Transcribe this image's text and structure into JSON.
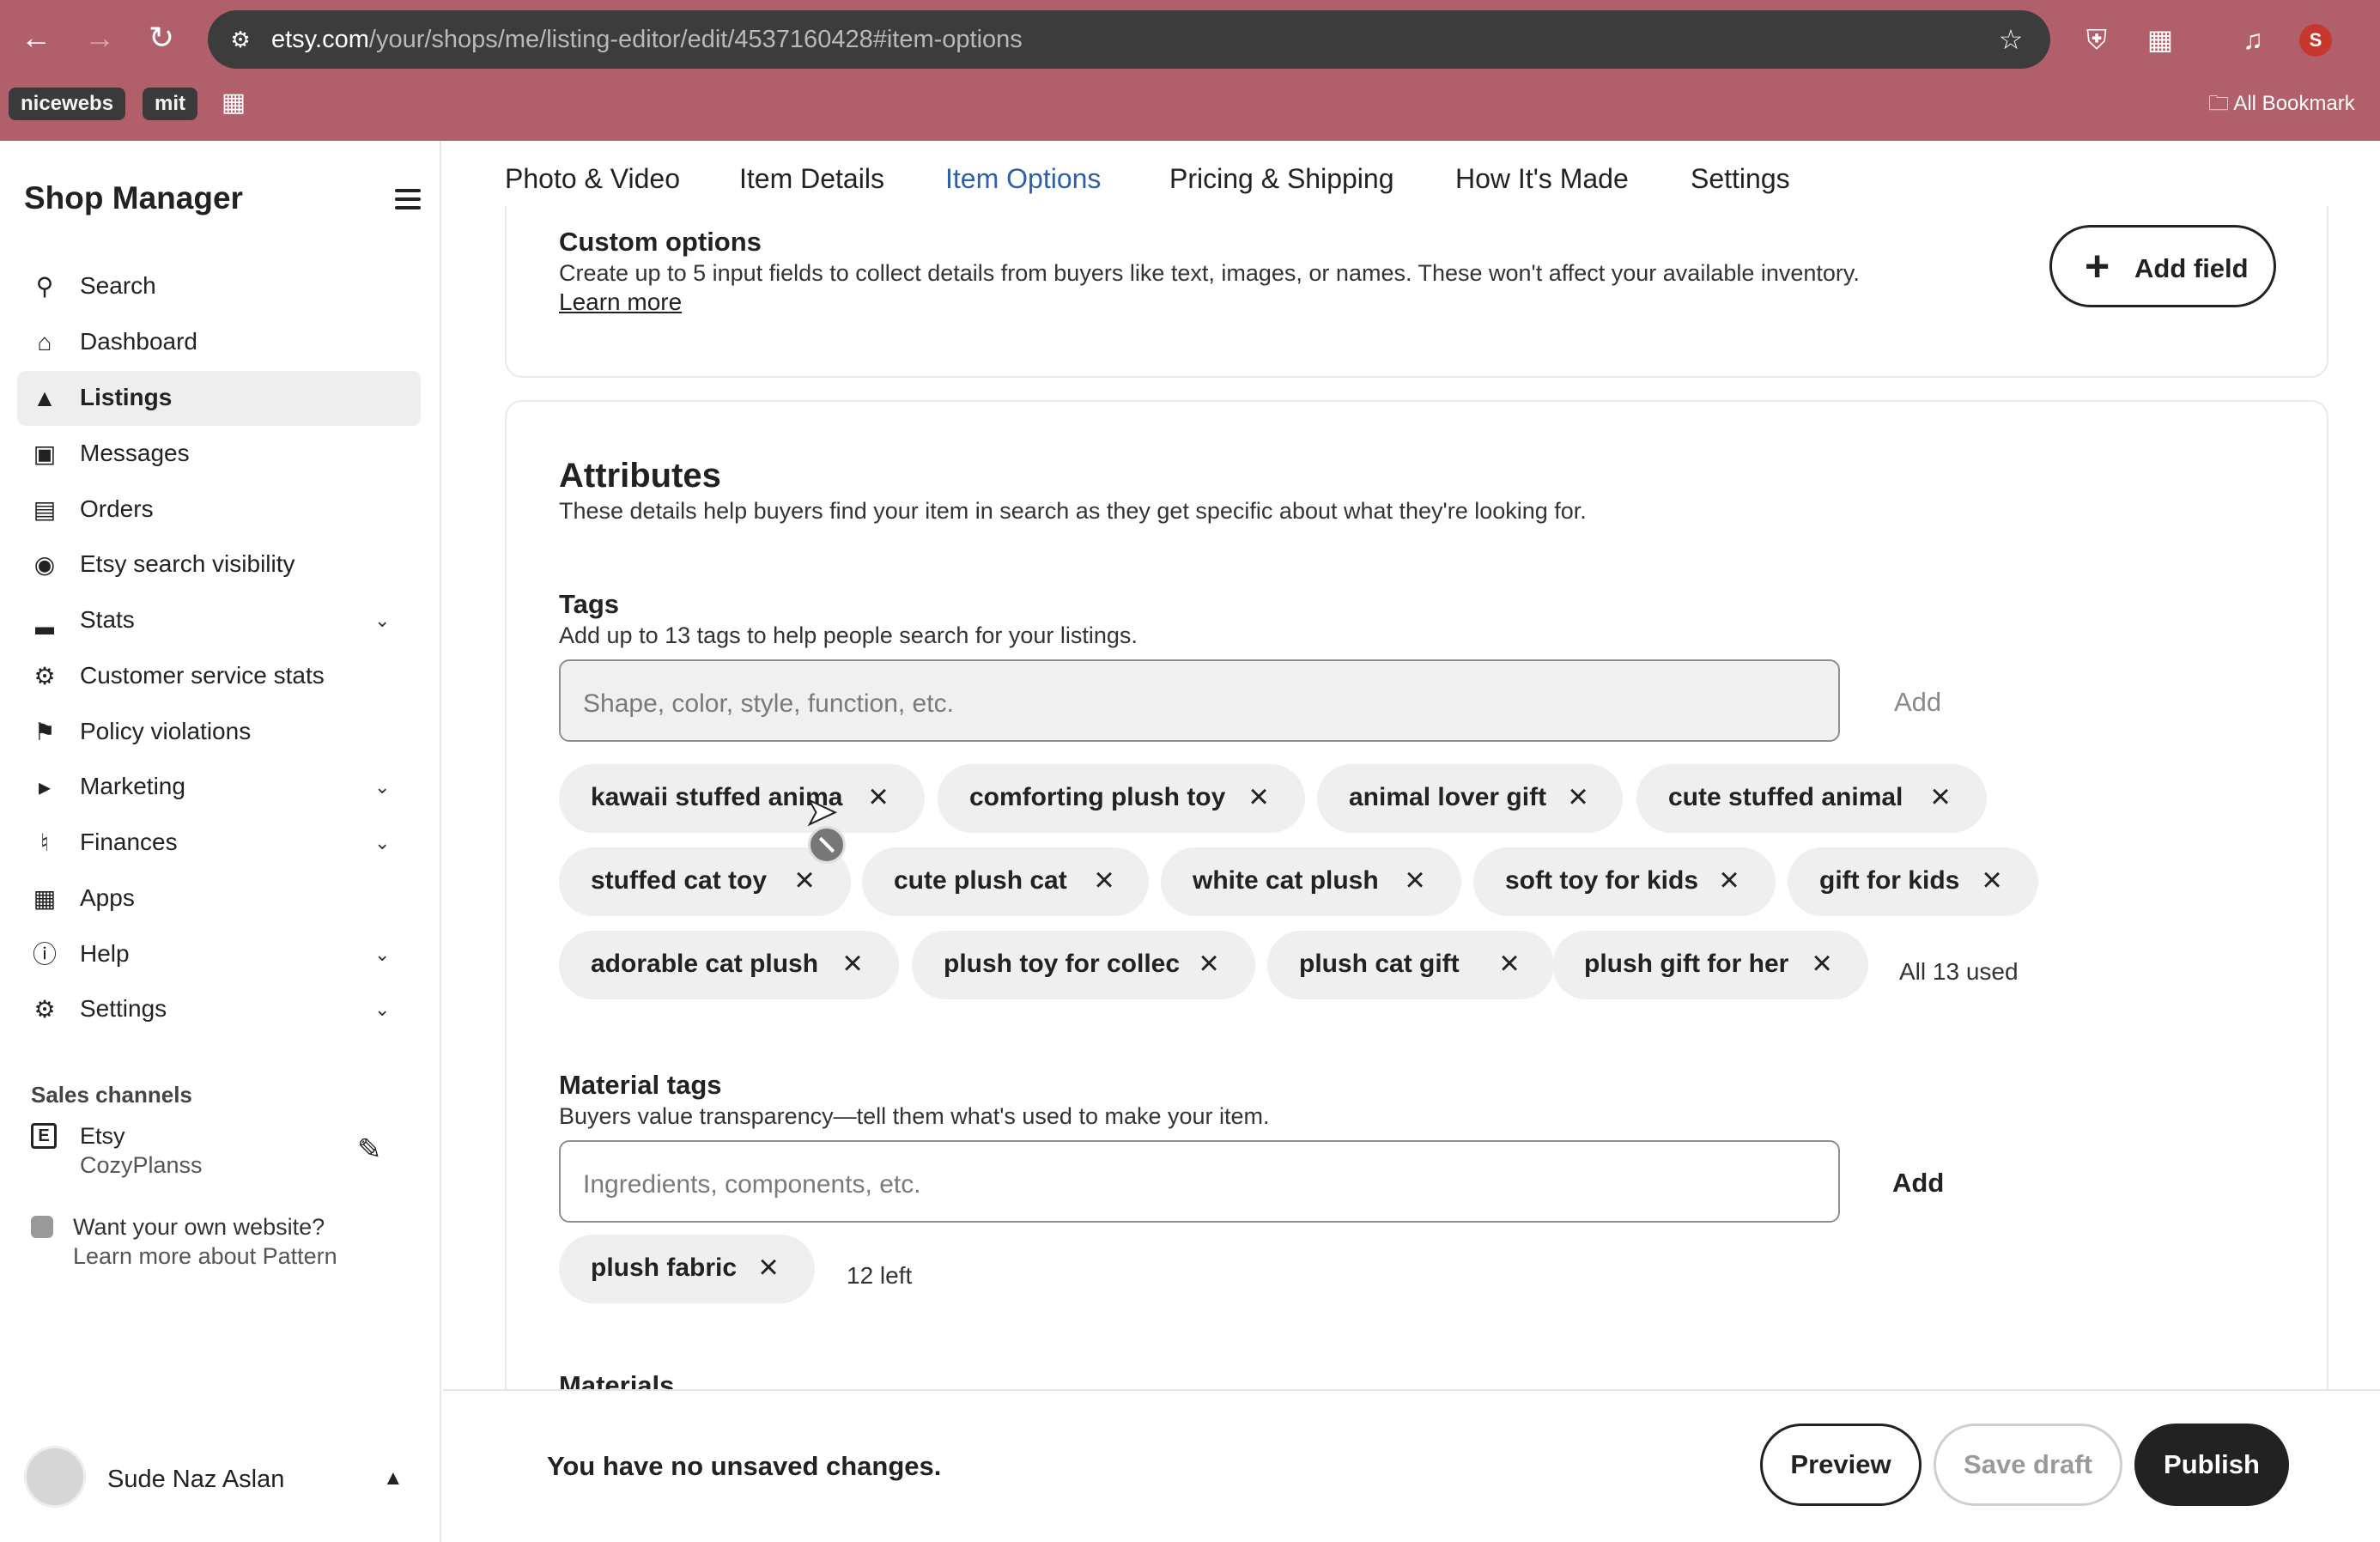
{
  "browser": {
    "url_host": "etsy.com",
    "url_path": "/your/shops/me/listing-editor/edit/4537160428#item-options",
    "profile_initial": "S",
    "bookmarks": [
      "nicewebs",
      "mit"
    ],
    "all_bookmarks_label": "All Bookmark"
  },
  "sidebar": {
    "title": "Shop Manager",
    "items": [
      {
        "label": "Search",
        "icon": "search-icon",
        "active": false,
        "expandable": false
      },
      {
        "label": "Dashboard",
        "icon": "home-icon",
        "active": false,
        "expandable": false
      },
      {
        "label": "Listings",
        "icon": "listings-icon",
        "active": true,
        "expandable": false
      },
      {
        "label": "Messages",
        "icon": "message-icon",
        "active": false,
        "expandable": false
      },
      {
        "label": "Orders",
        "icon": "orders-icon",
        "active": false,
        "expandable": false
      },
      {
        "label": "Etsy search visibility",
        "icon": "binoculars-icon",
        "active": false,
        "expandable": false
      },
      {
        "label": "Stats",
        "icon": "bar-chart-icon",
        "active": false,
        "expandable": true
      },
      {
        "label": "Customer service stats",
        "icon": "gear-badge-icon",
        "active": false,
        "expandable": false
      },
      {
        "label": "Policy violations",
        "icon": "flag-icon",
        "active": false,
        "expandable": false
      },
      {
        "label": "Marketing",
        "icon": "megaphone-icon",
        "active": false,
        "expandable": true
      },
      {
        "label": "Finances",
        "icon": "bank-icon",
        "active": false,
        "expandable": true
      },
      {
        "label": "Apps",
        "icon": "grid-icon",
        "active": false,
        "expandable": false
      },
      {
        "label": "Help",
        "icon": "help-icon",
        "active": false,
        "expandable": true
      },
      {
        "label": "Settings",
        "icon": "gear-icon",
        "active": false,
        "expandable": true
      }
    ],
    "sales_channels_title": "Sales channels",
    "channel_name": "Etsy",
    "channel_shop": "CozyPlanss",
    "pattern_line1": "Want your own website?",
    "pattern_line2": "Learn more about Pattern",
    "user_name": "Sude Naz Aslan"
  },
  "tabs": [
    "Photo & Video",
    "Item Details",
    "Item Options",
    "Pricing & Shipping",
    "How It's Made",
    "Settings"
  ],
  "active_tab": "Item Options",
  "custom_options": {
    "title": "Custom options",
    "description": "Create up to 5 input fields to collect details from buyers like text, images, or names. These won't affect your available inventory.",
    "learn_more": "Learn more",
    "add_field_label": "Add field"
  },
  "attributes": {
    "title": "Attributes",
    "description": "These details help buyers find your item in search as they get specific about what they're looking for."
  },
  "tags": {
    "title": "Tags",
    "description": "Add up to 13 tags to help people search for your listings.",
    "placeholder": "Shape, color, style, function, etc.",
    "add_label": "Add",
    "items": [
      "kawaii stuffed anima",
      "comforting plush toy",
      "animal lover gift",
      "cute stuffed animal",
      "stuffed cat toy",
      "cute plush cat",
      "white cat plush",
      "soft toy for kids",
      "gift for kids",
      "adorable cat plush",
      "plush toy for collec",
      "plush cat gift",
      "plush gift for her"
    ],
    "count_text": "All 13 used"
  },
  "material_tags": {
    "title": "Material tags",
    "description": "Buyers value transparency—tell them what's used to make your item.",
    "placeholder": "Ingredients, components, etc.",
    "add_label": "Add",
    "items": [
      "plush fabric"
    ],
    "count_text": "12 left"
  },
  "materials_peek": "Materials",
  "footer": {
    "message": "You have no unsaved changes.",
    "preview_label": "Preview",
    "save_draft_label": "Save draft",
    "publish_label": "Publish"
  }
}
